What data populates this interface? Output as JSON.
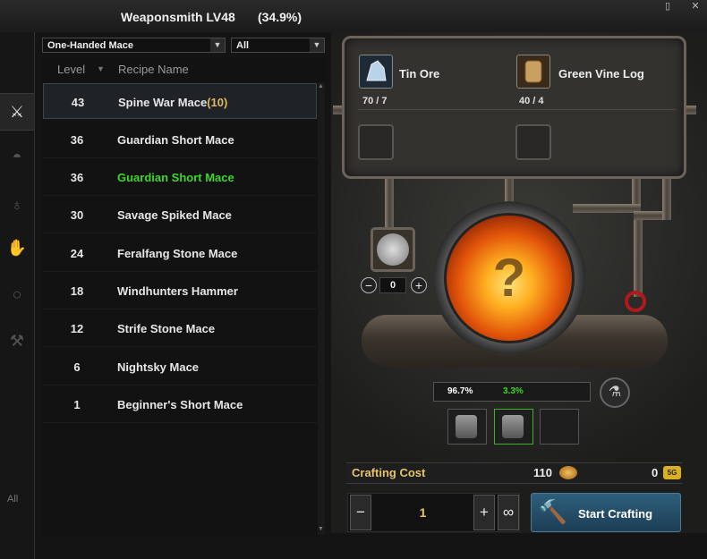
{
  "window": {
    "title": "Weaponsmith LV48",
    "progress": "(34.9%)"
  },
  "corner_buttons": [
    "▯",
    "✕"
  ],
  "tabs": [
    {
      "name": "mace",
      "icon": "crossed-swords-icon",
      "glyph": "⚔",
      "active": true
    },
    {
      "name": "armor",
      "icon": "armor-icon",
      "glyph": "◓",
      "active": false
    },
    {
      "name": "potion",
      "icon": "potion-icon",
      "glyph": "♁",
      "active": false
    },
    {
      "name": "gloves",
      "icon": "gloves-icon",
      "glyph": "✋",
      "active": false
    },
    {
      "name": "ring",
      "icon": "ring-icon",
      "glyph": "○",
      "active": false
    },
    {
      "name": "tools",
      "icon": "hammer-icon",
      "glyph": "⚒",
      "active": false
    }
  ],
  "tab_all": "All",
  "filters": {
    "category": "One-Handed Mace",
    "tier": "All"
  },
  "list_header": {
    "level": "Level",
    "name": "Recipe Name"
  },
  "recipes": [
    {
      "level": "43",
      "name": "Spine War Mace",
      "count": "(10)",
      "selected": true,
      "green": false
    },
    {
      "level": "36",
      "name": "Guardian Short Mace",
      "count": "",
      "selected": false,
      "green": false
    },
    {
      "level": "36",
      "name": "Guardian Short Mace",
      "count": "",
      "selected": false,
      "green": true
    },
    {
      "level": "30",
      "name": "Savage Spiked Mace",
      "count": "",
      "selected": false,
      "green": false
    },
    {
      "level": "24",
      "name": "Feralfang Stone Mace",
      "count": "",
      "selected": false,
      "green": false
    },
    {
      "level": "18",
      "name": "Windhunters Hammer",
      "count": "",
      "selected": false,
      "green": false
    },
    {
      "level": "12",
      "name": "Strife Stone Mace",
      "count": "",
      "selected": false,
      "green": false
    },
    {
      "level": "6",
      "name": "Nightsky Mace",
      "count": "",
      "selected": false,
      "green": false
    },
    {
      "level": "1",
      "name": "Beginner's Short Mace",
      "count": "",
      "selected": false,
      "green": false
    }
  ],
  "materials": [
    {
      "name": "Tin Ore",
      "count": "70 / 7",
      "icon": "ore-icon"
    },
    {
      "name": "Green Vine Log",
      "count": "40 / 4",
      "icon": "log-icon"
    }
  ],
  "fuel": {
    "quantity": "0",
    "minus": "−",
    "plus": "+",
    "icon": "ore-pile-icon"
  },
  "furnace": {
    "glyph": "?"
  },
  "result": {
    "rates": [
      "96.7%",
      "3.3%"
    ],
    "rate_colors": [
      "#ffffff",
      "#3fd62a"
    ]
  },
  "cost": {
    "label": "Crafting Cost",
    "amount": "110",
    "points": "0",
    "points_icon": "5G"
  },
  "quantity": {
    "value": "1",
    "minus": "−",
    "plus": "+",
    "max": "∞"
  },
  "craft": {
    "label": "Start Crafting",
    "icon": "hammer-icon"
  }
}
